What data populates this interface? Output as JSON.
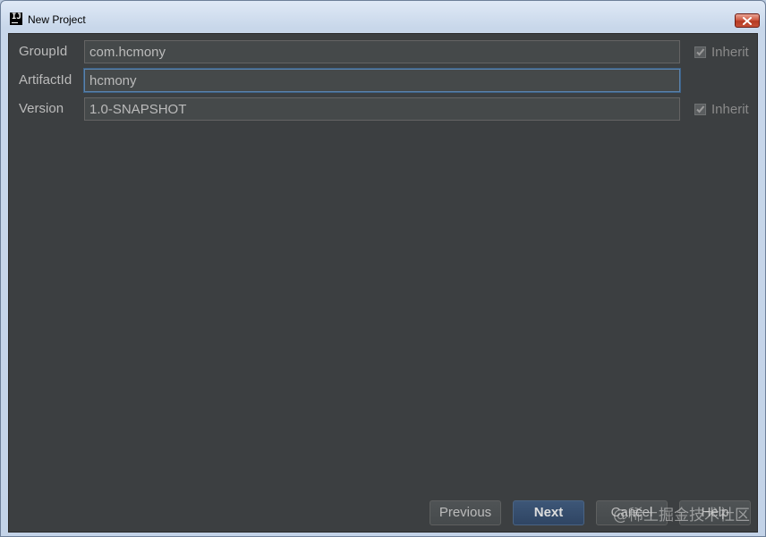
{
  "window": {
    "title": "New Project",
    "app_icon_text": "IJ"
  },
  "form": {
    "group_id": {
      "label": "GroupId",
      "value": "com.hcmony"
    },
    "artifact_id": {
      "label": "ArtifactId",
      "value": "hcmony"
    },
    "version": {
      "label": "Version",
      "value": "1.0-SNAPSHOT"
    },
    "inherit_label": "Inherit",
    "group_inherit_checked": true,
    "version_inherit_checked": true
  },
  "buttons": {
    "previous": "Previous",
    "next": "Next",
    "cancel": "Cancel",
    "help": "Help"
  },
  "watermark": "@稀土掘金技术社区",
  "colors": {
    "dialog_bg": "#3c3f41",
    "field_bg": "#45494a",
    "text": "#bbbbbb",
    "default_button": "#365880"
  }
}
